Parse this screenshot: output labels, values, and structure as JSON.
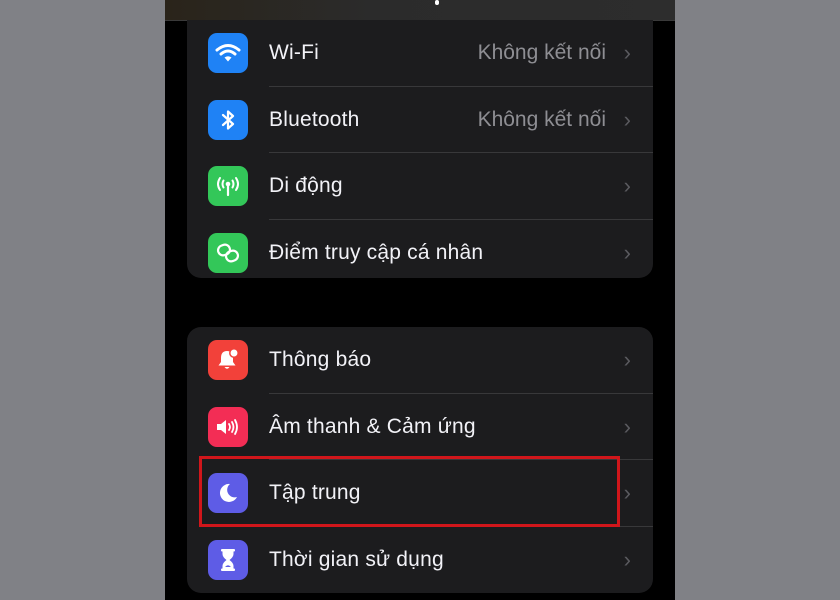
{
  "colors": {
    "background": "#808186",
    "screen": "#000000",
    "card": "#1c1c1e",
    "label": "#f2f2f7",
    "secondary": "#8e8e93",
    "highlight": "#d0161b"
  },
  "groups": [
    {
      "items": [
        {
          "label": "Wi-Fi",
          "value": "Không kết nối",
          "icon": "wifi-icon",
          "icon_color": "#1f82f5"
        },
        {
          "label": "Bluetooth",
          "value": "Không kết nối",
          "icon": "bluetooth-icon",
          "icon_color": "#1f82f5"
        },
        {
          "label": "Di động",
          "value": "",
          "icon": "cellular-antenna-icon",
          "icon_color": "#33c759"
        },
        {
          "label": "Điểm truy cập cá nhân",
          "value": "",
          "icon": "personal-hotspot-icon",
          "icon_color": "#33c759"
        }
      ]
    },
    {
      "items": [
        {
          "label": "Thông báo",
          "value": "",
          "icon": "notification-bell-icon",
          "icon_color": "#f2413a"
        },
        {
          "label": "Âm thanh & Cảm ứng",
          "value": "",
          "icon": "speaker-sound-icon",
          "icon_color": "#f32d55"
        },
        {
          "label": "Tập trung",
          "value": "",
          "icon": "focus-moon-icon",
          "icon_color": "#5e5ce6",
          "highlighted": true
        },
        {
          "label": "Thời gian sử dụng",
          "value": "",
          "icon": "screen-time-hourglass-icon",
          "icon_color": "#5e5ce6"
        }
      ]
    }
  ],
  "chevron": "›"
}
